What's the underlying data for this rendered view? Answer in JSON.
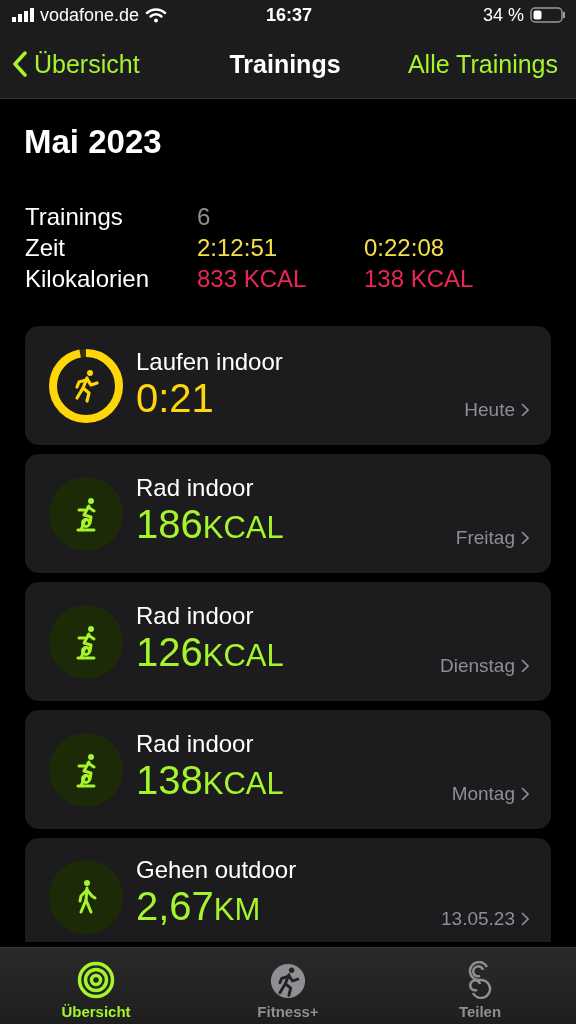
{
  "status_bar": {
    "carrier": "vodafone.de",
    "time": "16:37",
    "battery": "34 %"
  },
  "nav": {
    "back": "Übersicht",
    "title": "Trainings",
    "action": "Alle Trainings"
  },
  "heading": "Mai 2023",
  "stats": [
    {
      "label": "Trainings",
      "total": "6",
      "kind": "count"
    },
    {
      "label": "Zeit",
      "total": "2:12:51",
      "average": "0:22:08",
      "kind": "time"
    },
    {
      "label": "Kilokalorien",
      "total": "833 KCAL",
      "average": "138 KCAL",
      "kind": "energy"
    }
  ],
  "workouts": [
    {
      "kind": "running",
      "title": "Laufen indoor",
      "value": "0:21",
      "date": "Heute",
      "color": "#ffd60a",
      "ring": true
    },
    {
      "kind": "cycling",
      "title": "Rad indoor",
      "value": "186",
      "unit": "KCAL",
      "date": "Freitag",
      "color": "#a6f52c"
    },
    {
      "kind": "cycling",
      "title": "Rad indoor",
      "value": "126",
      "unit": "KCAL",
      "date": "Dienstag",
      "color": "#a6f52c"
    },
    {
      "kind": "cycling",
      "title": "Rad indoor",
      "value": "138",
      "unit": "KCAL",
      "date": "Montag",
      "color": "#a6f52c"
    },
    {
      "kind": "walking",
      "title": "Gehen outdoor",
      "value": "2,67",
      "unit": "KM",
      "date": "13.05.23",
      "color": "#a6f52c"
    }
  ],
  "tabs": [
    {
      "label": "Übersicht",
      "kind": "rings",
      "selected": true
    },
    {
      "label": "Fitness+",
      "kind": "fitness",
      "selected": false
    },
    {
      "label": "Teilen",
      "kind": "share",
      "selected": false
    }
  ]
}
